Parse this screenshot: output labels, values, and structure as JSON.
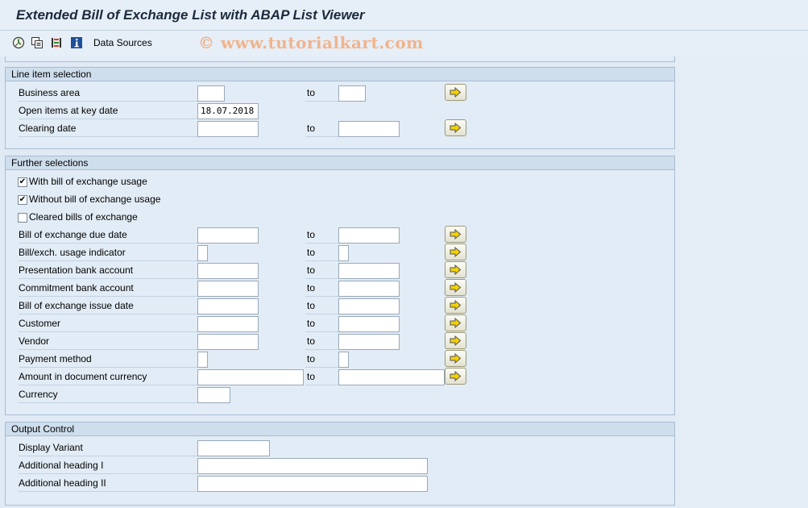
{
  "window": {
    "title": "Extended Bill of Exchange List with ABAP List Viewer",
    "watermark": "© www.tutorialkart.com"
  },
  "toolbar": {
    "icons": [
      "execute-icon",
      "copy-variant-icon",
      "selection-options-icon",
      "info-icon"
    ],
    "data_sources_label": "Data Sources"
  },
  "line_item_selection": {
    "title": "Line item selection",
    "to_label": "to",
    "rows": [
      {
        "label": "Business area",
        "low": "",
        "high": ""
      },
      {
        "label": "Open items at key date",
        "low": "18.07.2018"
      },
      {
        "label": "Clearing date",
        "low": "",
        "high": ""
      }
    ]
  },
  "further_selections": {
    "title": "Further selections",
    "to_label": "to",
    "checkboxes": [
      {
        "label": "With bill of exchange usage",
        "checked": true,
        "mark": "✔"
      },
      {
        "label": "Without bill of exchange usage",
        "checked": true,
        "mark": "✔"
      },
      {
        "label": "Cleared bills of exchange",
        "checked": false,
        "mark": ""
      }
    ],
    "rows": [
      {
        "label": "Bill of exchange due date",
        "low": "",
        "high": ""
      },
      {
        "label": "Bill/exch. usage indicator",
        "low": "",
        "high": ""
      },
      {
        "label": "Presentation bank account",
        "low": "",
        "high": ""
      },
      {
        "label": "Commitment bank account",
        "low": "",
        "high": ""
      },
      {
        "label": "Bill of exchange issue date",
        "low": "",
        "high": ""
      },
      {
        "label": "Customer",
        "low": "",
        "high": ""
      },
      {
        "label": "Vendor",
        "low": "",
        "high": ""
      },
      {
        "label": "Payment method",
        "low": "",
        "high": ""
      },
      {
        "label": "Amount in document currency",
        "low": "",
        "high": ""
      },
      {
        "label": "Currency",
        "low": ""
      }
    ]
  },
  "output_control": {
    "title": "Output Control",
    "rows": [
      {
        "label": "Display Variant",
        "value": ""
      },
      {
        "label": "Additional heading I",
        "value": ""
      },
      {
        "label": "Additional heading II",
        "value": ""
      }
    ]
  },
  "colors": {
    "background": "#dfeaf5",
    "group_header": "#cfdeed",
    "arrow_button": "#f4d200"
  }
}
